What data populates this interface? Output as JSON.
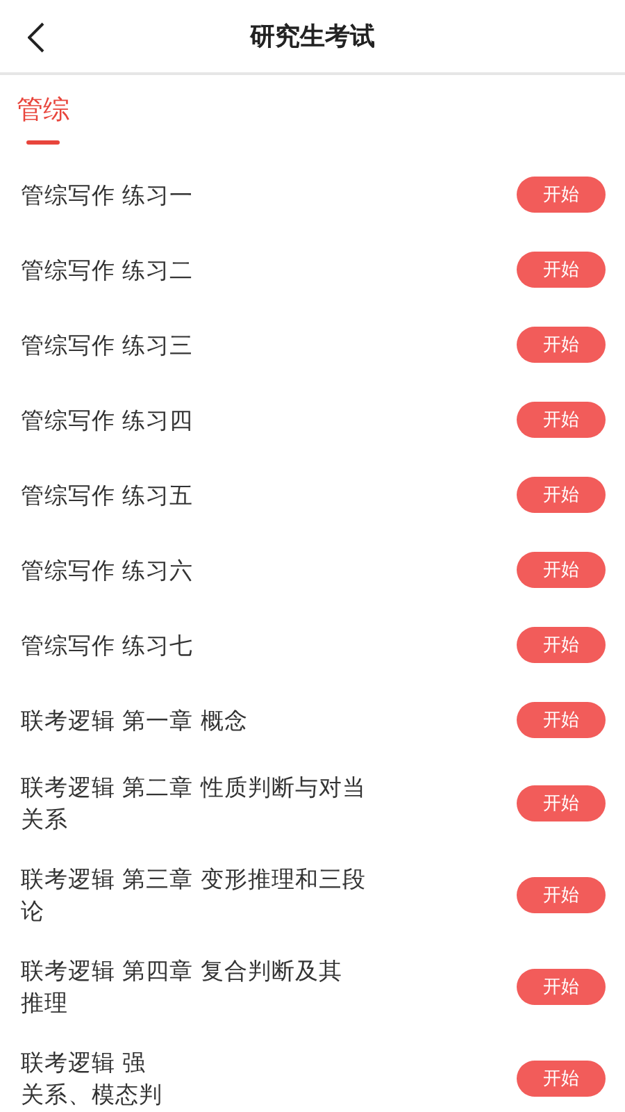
{
  "header": {
    "title": "研究生考试"
  },
  "tabs": [
    {
      "label": "管综",
      "selected": true
    }
  ],
  "items": [
    {
      "lines": [
        "管综写作 练习一"
      ],
      "button": "开始"
    },
    {
      "lines": [
        "管综写作 练习二"
      ],
      "button": "开始"
    },
    {
      "lines": [
        "管综写作 练习三"
      ],
      "button": "开始"
    },
    {
      "lines": [
        "管综写作 练习四"
      ],
      "button": "开始"
    },
    {
      "lines": [
        "管综写作 练习五"
      ],
      "button": "开始"
    },
    {
      "lines": [
        "管综写作 练习六"
      ],
      "button": "开始"
    },
    {
      "lines": [
        "管综写作 练习七"
      ],
      "button": "开始"
    },
    {
      "lines": [
        "联考逻辑 第一章 概念"
      ],
      "button": "开始"
    },
    {
      "lines": [
        "联考逻辑 第二章 性质判断与对当",
        "关系"
      ],
      "button": "开始"
    },
    {
      "lines": [
        "联考逻辑 第三章 变形推理和三段",
        "论"
      ],
      "button": "开始"
    },
    {
      "lines": [
        "联考逻辑 第四章 复合判断及其",
        "推理"
      ],
      "button": "开始"
    },
    {
      "lines": [
        "联考逻辑 强",
        "关系、模态判"
      ],
      "button": "开始"
    }
  ]
}
